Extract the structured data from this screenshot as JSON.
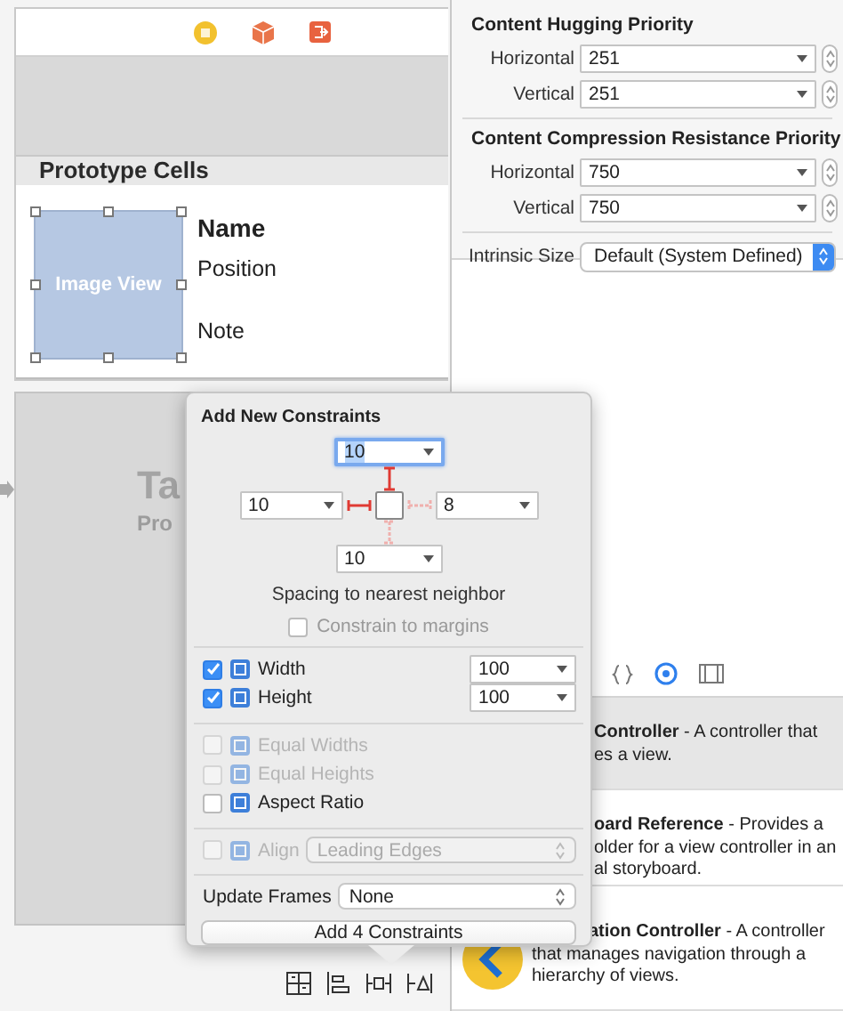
{
  "canvas": {
    "section_header": "Prototype Cells",
    "cell": {
      "image_label": "Image View",
      "title": "Name",
      "subtitle": "Position",
      "note": "Note"
    },
    "second_scene": {
      "title": "Ta",
      "subtitle": "Pro"
    }
  },
  "size_inspector": {
    "sections": [
      {
        "title": "Content Hugging Priority",
        "rows": [
          {
            "label": "Horizontal",
            "value": "251"
          },
          {
            "label": "Vertical",
            "value": "251"
          }
        ]
      },
      {
        "title": "Content Compression Resistance Priority",
        "rows": [
          {
            "label": "Horizontal",
            "value": "750"
          },
          {
            "label": "Vertical",
            "value": "750"
          }
        ]
      }
    ],
    "intrinsic_size": {
      "label": "Intrinsic Size",
      "value": "Default (System Defined)"
    }
  },
  "popover": {
    "title": "Add New Constraints",
    "spacing": [
      {
        "value": "10",
        "on": true,
        "focused": true
      },
      {
        "value": "10",
        "on": true,
        "focused": false
      },
      {
        "value": "8",
        "on": false,
        "focused": false
      },
      {
        "value": "10",
        "on": false,
        "focused": false
      }
    ],
    "spacing_caption": "Spacing to nearest neighbor",
    "constrain_to_margins": {
      "label": "Constrain to margins",
      "checked": false
    },
    "options": [
      {
        "kind": "field",
        "label": "Width",
        "checked": true,
        "disabled": false,
        "value": "100"
      },
      {
        "kind": "field",
        "label": "Height",
        "checked": true,
        "disabled": false,
        "value": "100"
      },
      {
        "kind": "plain",
        "label": "Equal Widths",
        "checked": false,
        "disabled": true
      },
      {
        "kind": "plain",
        "label": "Equal Heights",
        "checked": false,
        "disabled": true
      },
      {
        "kind": "plain",
        "label": "Aspect Ratio",
        "checked": false,
        "disabled": false
      },
      {
        "kind": "select",
        "label": "Align",
        "checked": false,
        "disabled": true,
        "value": "Leading Edges"
      }
    ],
    "update_frames": {
      "label": "Update Frames",
      "value": "None"
    },
    "button": "Add 4 Constraints"
  },
  "library": {
    "items": [
      {
        "selected": true,
        "lines": [
          "**Controller** - A controller that",
          "es a view."
        ]
      },
      {
        "selected": false,
        "lines": [
          "**oard Reference** - Provides a",
          "older for a view controller in an",
          "al storyboard."
        ]
      },
      {
        "selected": false,
        "lines": [
          "**ation Controller** - A controller",
          "that manages navigation through a",
          "hierarchy of views."
        ]
      }
    ]
  }
}
